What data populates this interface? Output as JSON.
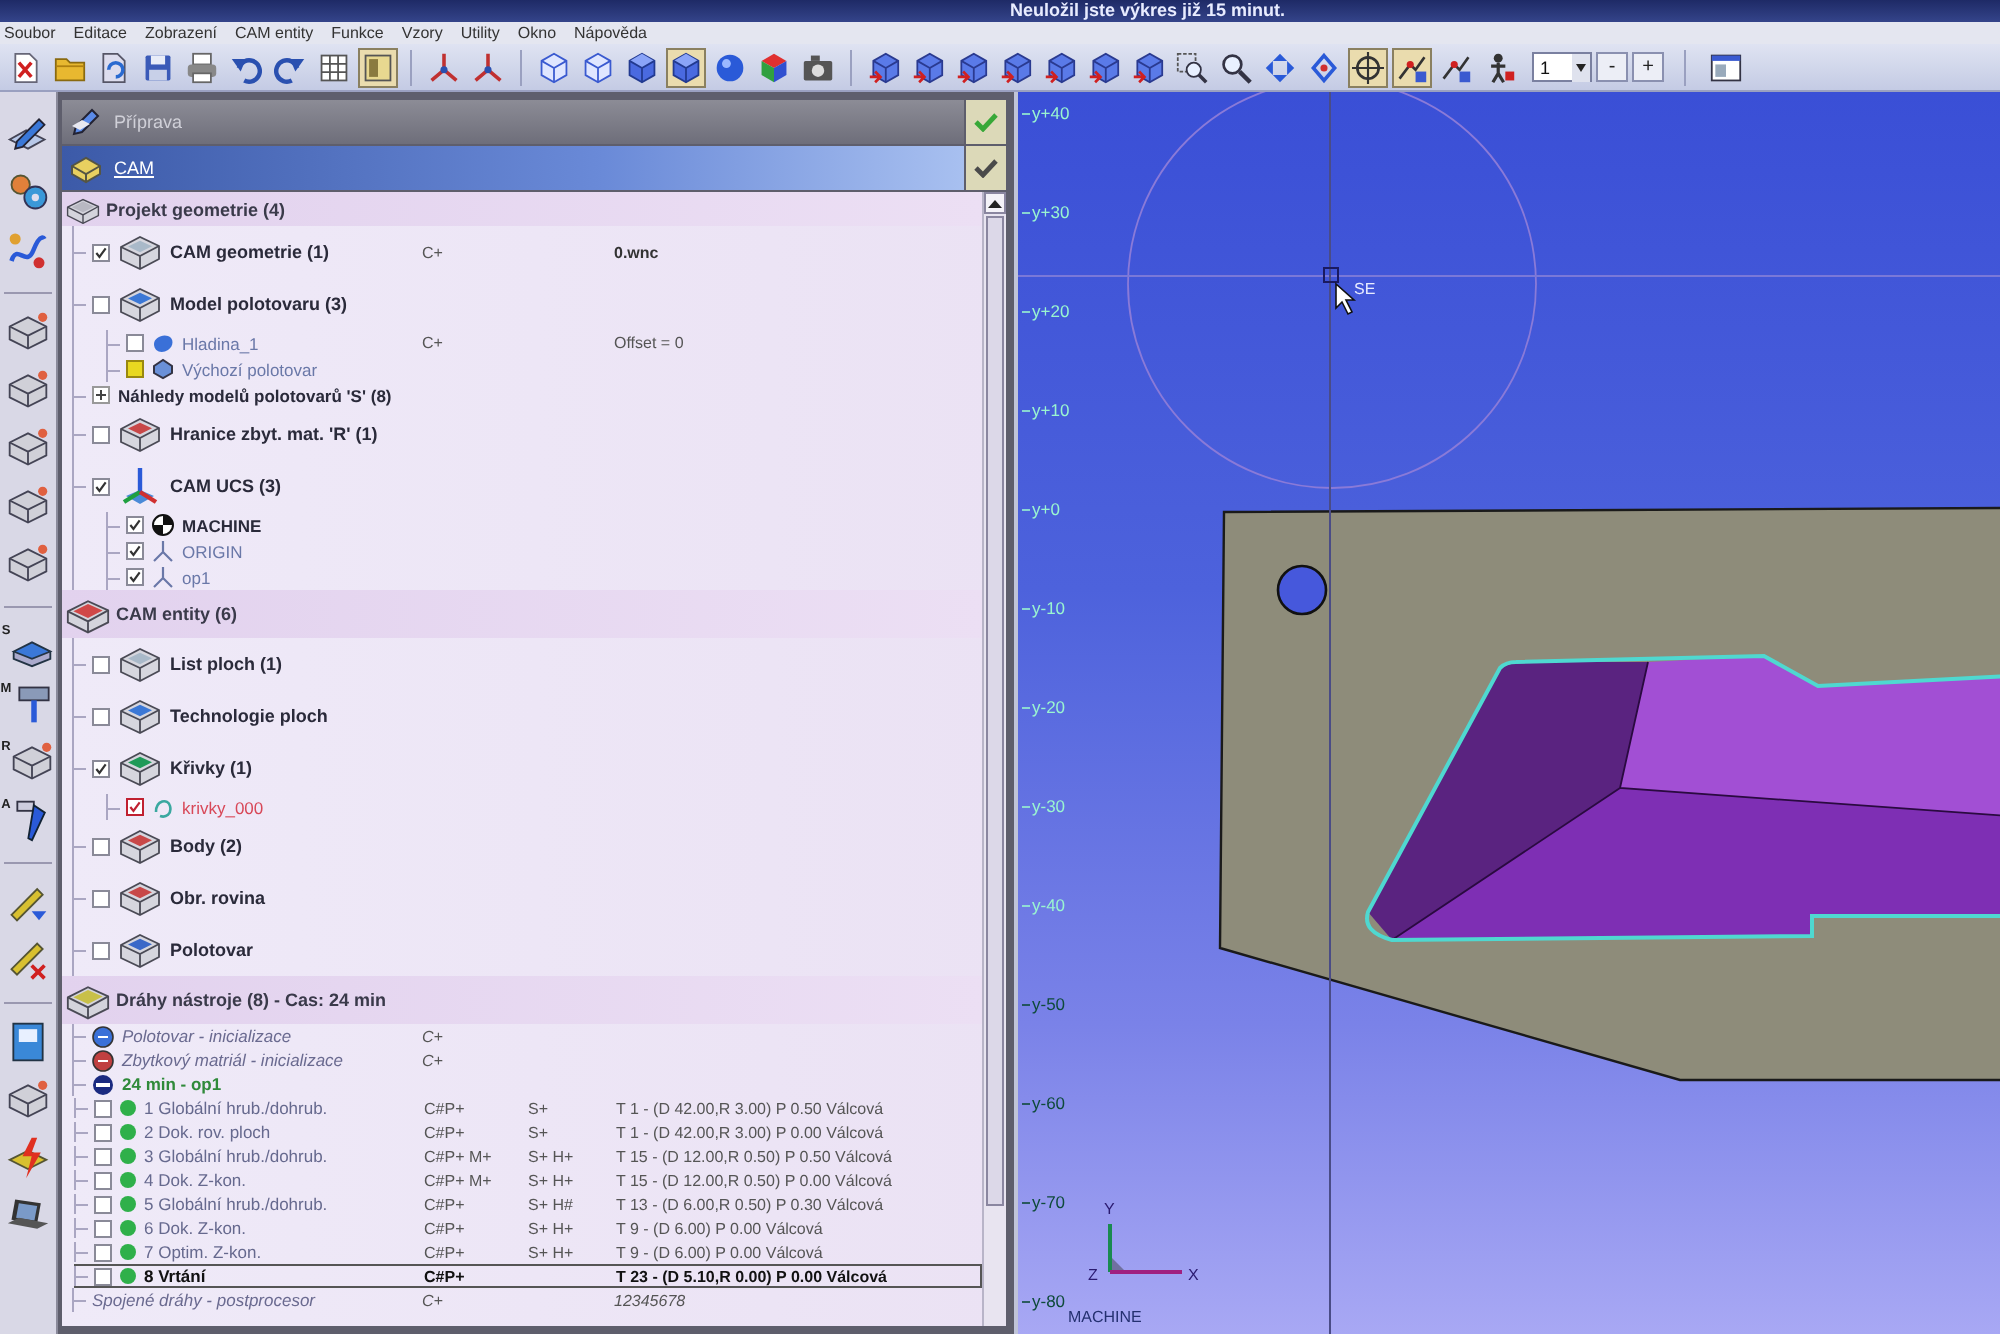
{
  "window": {
    "title": "Neuložil jste výkres již 15 minut."
  },
  "menu": [
    "Soubor",
    "Editace",
    "Zobrazení",
    "CAM entity",
    "Funkce",
    "Vzory",
    "Utility",
    "Okno",
    "Nápověda"
  ],
  "toolbar": {
    "groups": [
      {
        "tools": [
          {
            "kind": "close-doc",
            "pressed": false
          },
          {
            "kind": "folder",
            "pressed": false
          },
          {
            "kind": "export",
            "pressed": false
          },
          {
            "kind": "save",
            "pressed": false
          },
          {
            "kind": "print",
            "pressed": false
          },
          {
            "kind": "undo",
            "pressed": false
          },
          {
            "kind": "redo",
            "pressed": false
          },
          {
            "kind": "grid",
            "pressed": false
          },
          {
            "kind": "panel",
            "pressed": true
          }
        ]
      },
      {
        "tools": [
          {
            "kind": "axes",
            "pressed": false
          },
          {
            "kind": "axes",
            "pressed": false
          }
        ]
      },
      {
        "tools": [
          {
            "kind": "cube-wire",
            "pressed": false
          },
          {
            "kind": "cube-wire",
            "pressed": false
          },
          {
            "kind": "cube-solid",
            "pressed": false
          },
          {
            "kind": "cube-solid",
            "pressed": true
          },
          {
            "kind": "sphere",
            "pressed": false
          },
          {
            "kind": "cube-color",
            "pressed": false
          },
          {
            "kind": "camera",
            "pressed": false
          }
        ]
      },
      {
        "tools": [
          {
            "kind": "view-cube",
            "pressed": false
          },
          {
            "kind": "view-cube",
            "pressed": false
          },
          {
            "kind": "view-cube",
            "pressed": false
          },
          {
            "kind": "view-cube",
            "pressed": false
          },
          {
            "kind": "view-cube",
            "pressed": false
          },
          {
            "kind": "view-cube",
            "pressed": false
          },
          {
            "kind": "view-cube",
            "pressed": false
          },
          {
            "kind": "zoom-window",
            "pressed": false
          },
          {
            "kind": "zoom",
            "pressed": false
          },
          {
            "kind": "pan",
            "pressed": false
          },
          {
            "kind": "rotate",
            "pressed": false
          },
          {
            "kind": "crosshair",
            "pressed": true
          },
          {
            "kind": "snap",
            "pressed": true
          },
          {
            "kind": "snap",
            "pressed": false
          },
          {
            "kind": "person",
            "pressed": false
          }
        ]
      }
    ],
    "step": {
      "value": "1",
      "buttons": [
        "-",
        "+"
      ]
    },
    "trailing_tools": [
      {
        "kind": "window",
        "pressed": false
      }
    ]
  },
  "side_toolbar": {
    "groups": [
      {
        "tools": [
          {
            "kind": "pencil-block"
          },
          {
            "kind": "gears"
          },
          {
            "kind": "curve-tool"
          }
        ]
      },
      {
        "tools": [
          {
            "kind": "block"
          },
          {
            "kind": "block"
          },
          {
            "kind": "block"
          },
          {
            "kind": "block"
          },
          {
            "kind": "block"
          }
        ]
      },
      {
        "tools": [
          {
            "kind": "plate",
            "badge": "S"
          },
          {
            "kind": "probe",
            "badge": "M"
          },
          {
            "kind": "block",
            "badge": "R"
          },
          {
            "kind": "drill",
            "badge": "A"
          }
        ]
      },
      {
        "tools": [
          {
            "kind": "wand"
          },
          {
            "kind": "wand-x"
          }
        ]
      },
      {
        "tools": [
          {
            "kind": "book"
          },
          {
            "kind": "block"
          },
          {
            "kind": "lightning"
          },
          {
            "kind": "laptop"
          }
        ]
      }
    ]
  },
  "panel_headers": [
    {
      "label": "Příprava",
      "selected": false
    },
    {
      "label": "CAM",
      "selected": true
    }
  ],
  "tree": [
    {
      "kind": "section",
      "label": "Projekt geometrie (4)",
      "children": [
        {
          "kind": "group",
          "label": "CAM geometrie (1)",
          "checked": true,
          "column_2": "C+",
          "column_4": "0.wnc"
        },
        {
          "kind": "group",
          "label": "Model polotovaru (3)",
          "checked": false,
          "children": [
            {
              "kind": "layer",
              "label": "Hladina_1",
              "checked": false,
              "column_2": "C+",
              "column_4": "Offset = 0"
            },
            {
              "kind": "stock",
              "label": "Výchozí polotovar"
            }
          ]
        },
        {
          "kind": "subgroup",
          "label": "Náhledy modelů polotovarů 'S' (8)"
        },
        {
          "kind": "group",
          "label": "Hranice zbyt. mat. 'R' (1)",
          "checked": false
        },
        {
          "kind": "ucs-group",
          "label": "CAM UCS (3)",
          "checked": true,
          "children": [
            {
              "kind": "machine",
              "label": "MACHINE",
              "checked": true
            },
            {
              "kind": "ucs",
              "label": "ORIGIN",
              "checked": true
            },
            {
              "kind": "ucs",
              "label": "op1",
              "checked": true
            }
          ]
        }
      ]
    },
    {
      "kind": "section",
      "label": "CAM entity (6)",
      "children": [
        {
          "kind": "group",
          "label": "List ploch (1)",
          "checked": false
        },
        {
          "kind": "group",
          "label": "Technologie ploch",
          "checked": false
        },
        {
          "kind": "group",
          "label": "Křivky (1)",
          "checked": true,
          "children": [
            {
              "kind": "curve",
              "label": "krivky_000",
              "checked": true
            }
          ]
        },
        {
          "kind": "group",
          "label": "Body (2)",
          "checked": false
        },
        {
          "kind": "group",
          "label": "Obr. rovina",
          "checked": false
        },
        {
          "kind": "group",
          "label": "Polotovar",
          "checked": false
        }
      ]
    },
    {
      "kind": "section",
      "label": "Dráhy nástroje (8) - Cas: 24 min",
      "children": [
        {
          "kind": "init",
          "label": "Polotovar - inicializace",
          "column_2": "C+"
        },
        {
          "kind": "init",
          "label": "Zbytkový matriál - inicializace",
          "column_2": "C+"
        },
        {
          "kind": "operation",
          "label": "24 min - op1"
        },
        {
          "kind": "toolpath",
          "label": "1 Globální hrub./dohrub.",
          "checked": false,
          "selected": false,
          "column_2": "C#P+",
          "column_3": "S+",
          "column_4": "T 1 - (D 42.00,R 3.00) P 0.50 Válcová"
        },
        {
          "kind": "toolpath",
          "label": "2 Dok. rov. ploch",
          "checked": false,
          "selected": false,
          "column_2": "C#P+",
          "column_3": "S+",
          "column_4": "T 1 - (D 42.00,R 3.00) P 0.00 Válcová"
        },
        {
          "kind": "toolpath",
          "label": "3 Globální hrub./dohrub.",
          "checked": false,
          "selected": false,
          "column_2": "C#P+ M+",
          "column_3": "S+ H+",
          "column_4": "T 15 - (D 12.00,R 0.50) P 0.50 Válcová"
        },
        {
          "kind": "toolpath",
          "label": "4 Dok. Z-kon.",
          "checked": false,
          "selected": false,
          "column_2": "C#P+ M+",
          "column_3": "S+ H+",
          "column_4": "T 15 - (D 12.00,R 0.50) P 0.00 Válcová"
        },
        {
          "kind": "toolpath",
          "label": "5 Globální hrub./dohrub.",
          "checked": false,
          "selected": false,
          "column_2": "C#P+",
          "column_3": "S+ H#",
          "column_4": "T 13 - (D 6.00,R 0.50) P 0.30 Válcová"
        },
        {
          "kind": "toolpath",
          "label": "6 Dok. Z-kon.",
          "checked": false,
          "selected": false,
          "column_2": "C#P+",
          "column_3": "S+ H+",
          "column_4": "T 9 - (D 6.00) P 0.00 Válcová"
        },
        {
          "kind": "toolpath",
          "label": "7 Optim. Z-kon.",
          "checked": false,
          "selected": false,
          "column_2": "C#P+",
          "column_3": "S+ H+",
          "column_4": "T 9 - (D 6.00) P 0.00 Válcová"
        },
        {
          "kind": "toolpath",
          "label": "8 Vrtání",
          "checked": false,
          "selected": true,
          "column_2": "C#P+",
          "column_4": "T 23 - (D 5.10,R 0.00) P 0.00 Válcová"
        },
        {
          "kind": "postprocessor",
          "label": "Spojené dráhy - postprocesor",
          "column_2": "C+",
          "column_4": "12345678"
        }
      ]
    }
  ],
  "canvas": {
    "ruler_labels": [
      "y+40",
      "y+30",
      "y+20",
      "y+10",
      "y+0",
      "y-10",
      "y-20",
      "y-30",
      "y-40",
      "y-50",
      "y-60",
      "y-70",
      "y-80"
    ],
    "snap_label": "SE",
    "triad": {
      "y_label": "Y",
      "z_label": "Z",
      "x_label": "X"
    },
    "ucs_name": "MACHINE"
  }
}
